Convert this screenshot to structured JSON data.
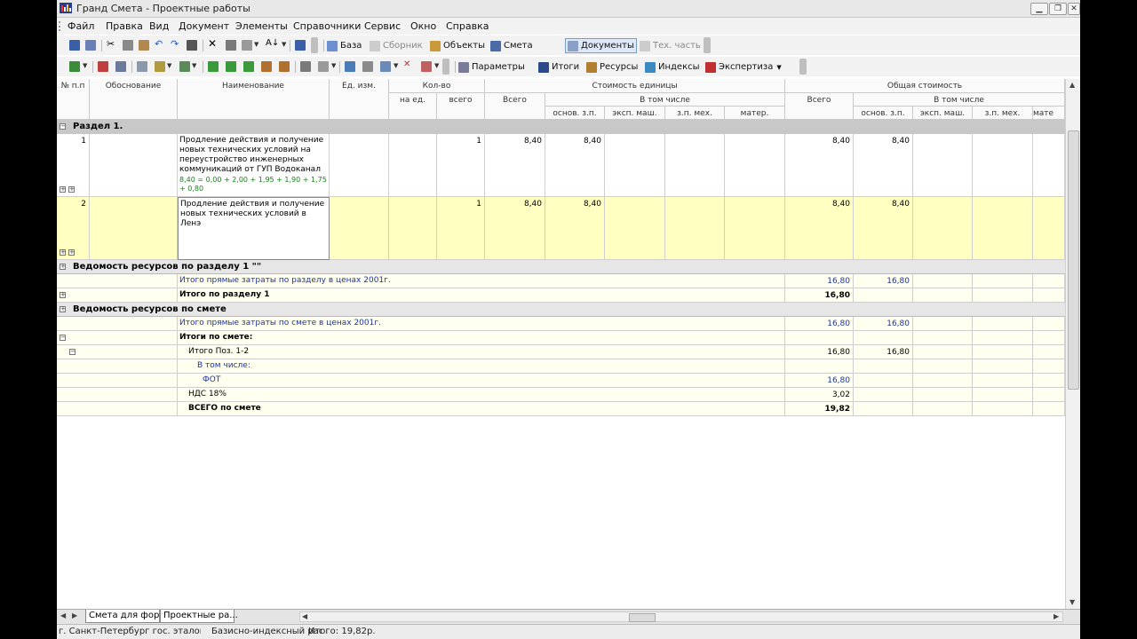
{
  "window": {
    "title": "Гранд Смета - Проектные работы"
  },
  "menu": [
    "Файл",
    "Правка",
    "Вид",
    "Документ",
    "Элементы",
    "Справочники",
    "Сервис",
    "Окно",
    "Справка"
  ],
  "toolbar1": {
    "baza": "База",
    "sbornik": "Сборник",
    "obekty": "Объекты",
    "smeta": "Смета",
    "dokumenty": "Документы",
    "tehchast": "Тех. часть"
  },
  "toolbar2": {
    "parametry": "Параметры",
    "itogi": "Итоги",
    "resursy": "Ресурсы",
    "indeksy": "Индексы",
    "ekspertiza": "Экспертиза"
  },
  "headers": {
    "num": "№ п.п",
    "obosnovanie": "Обоснование",
    "naimenovanie": "Наименование",
    "ed_izm": "Ед. изм.",
    "kolvo": "Кол-во",
    "na_ed": "на ед.",
    "vsego": "всего",
    "stoim_ed": "Стоимость единицы",
    "stoim_vsego": "Всего",
    "v_tom_chisle": "В том числе",
    "osn_zp": "основ. з.п.",
    "eksp_mash": "эксп. маш.",
    "zp_meh": "з.п. мех.",
    "mater": "матер.",
    "obsh_stoim": "Общая стоимость",
    "obsh_vsego": "Всего",
    "v_tom_chisle2": "В том числе",
    "osn_zp2": "основ. з.п.",
    "eksp_mash2": "эксп. маш.",
    "zp_meh2": "з.п. мех.",
    "mater2": "мате"
  },
  "section1": {
    "label": "Раздел 1."
  },
  "pos1": {
    "num": "1",
    "name": "Продление действия и получение новых технических условий на переустройство инженерных коммуникаций от ГУП Водоканал",
    "formula": "8,40 = 0,00 + 2,00 + 1,95 + 1,90 + 1,75 + 0,80",
    "qty": "1",
    "unit_total": "8,40",
    "unit_osn": "8,40",
    "total": "8,40",
    "total_osn": "8,40"
  },
  "pos2": {
    "num": "2",
    "name": "Продление действия и получение новых технических условий в Ленэ",
    "qty": "1",
    "unit_total": "8,40",
    "unit_osn": "8,40",
    "total": "8,40",
    "total_osn": "8,40"
  },
  "summary": {
    "res_section": "Ведомость ресурсов по разделу 1 \"\"",
    "direct_section_label": "Итого прямые затраты по разделу в ценах 2001г.",
    "direct_section_total": "16,80",
    "direct_section_osn": "16,80",
    "itogo_razdel_label": "Итого по разделу 1",
    "itogo_razdel_total": "16,80",
    "res_smeta": "Ведомость ресурсов по смете",
    "direct_smeta_label": "Итого прямые затраты по смете в ценах 2001г.",
    "direct_smeta_total": "16,80",
    "direct_smeta_osn": "16,80",
    "itogi_smeta_label": "Итоги по смете:",
    "itogo_poz_label": "Итого Поз. 1-2",
    "itogo_poz_total": "16,80",
    "itogo_poz_osn": "16,80",
    "v_tom_label": "В том числе:",
    "fot_label": "ФОТ",
    "fot_total": "16,80",
    "nds_label": "НДС 18%",
    "nds_total": "3,02",
    "vsego_label": "ВСЕГО по смете",
    "vsego_total": "19,82"
  },
  "tabs": {
    "tab1": "Смета для фор...",
    "tab2": "Проектные ра..."
  },
  "status": {
    "region": "г. Санкт-Петербург гос. эталон",
    "method": "Базисно-индексный расчё",
    "total": "Итого: 19,82р."
  },
  "colors": {
    "accent": "#1a33a6",
    "highlight_row": "#ffffc2",
    "section_bg": "#c8c8c8",
    "formula": "#1a7f1a"
  }
}
